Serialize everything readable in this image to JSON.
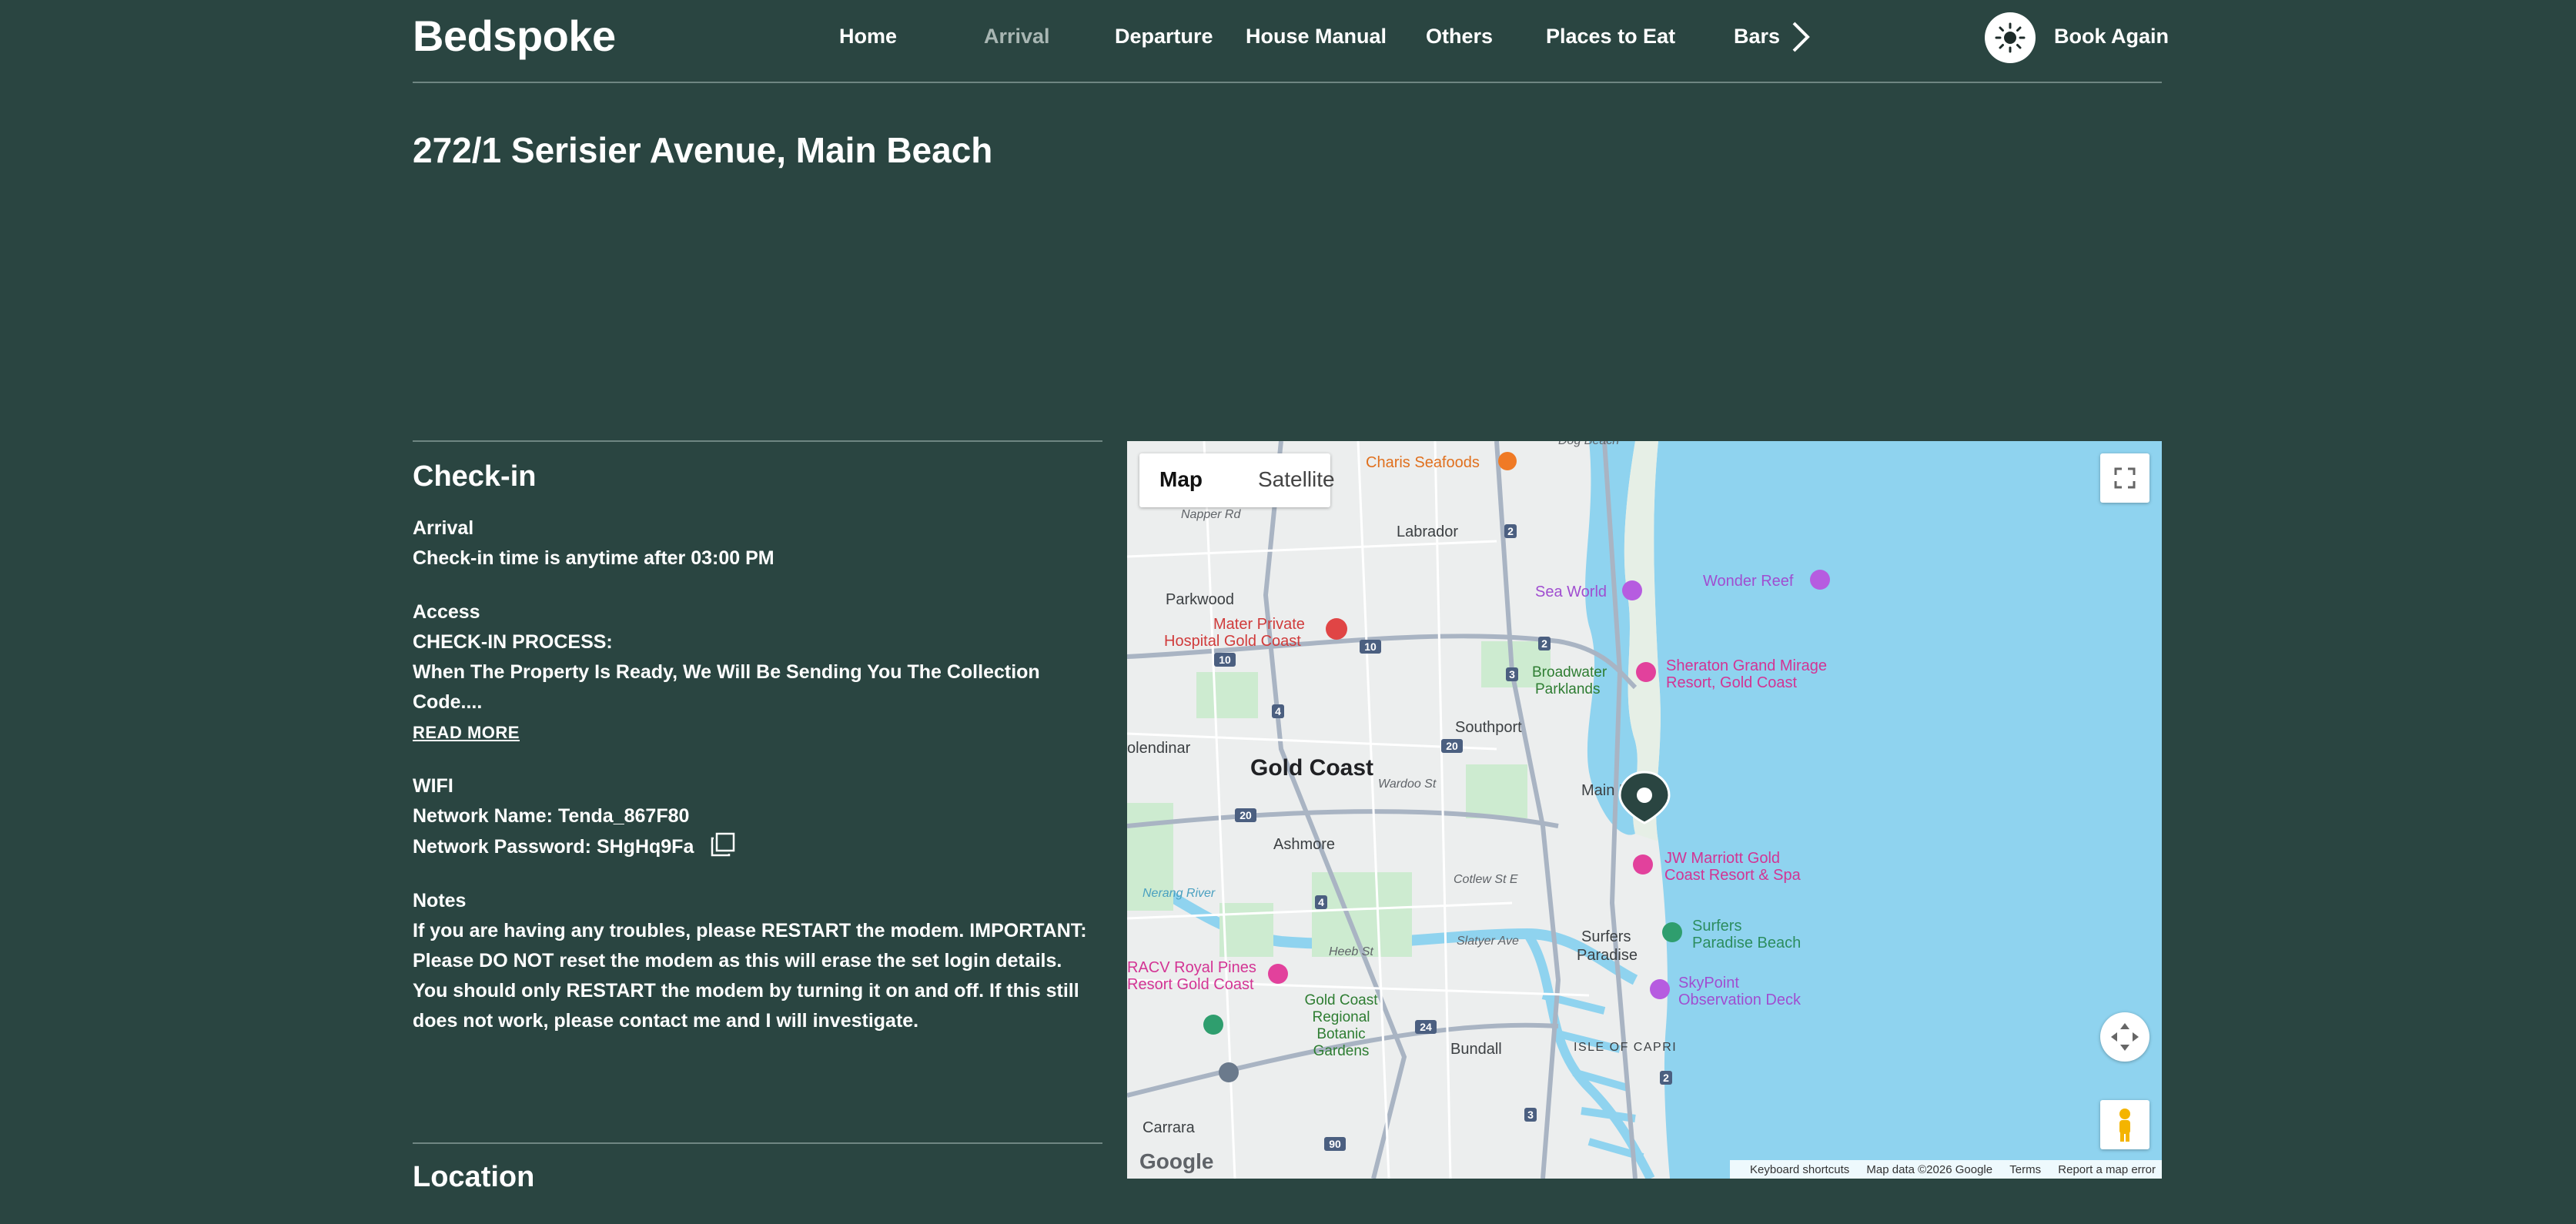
{
  "header": {
    "logo": "Bedspoke",
    "nav": [
      "Home",
      "Arrival",
      "Departure",
      "House Manual",
      "Others",
      "Places to Eat",
      "Bars"
    ],
    "active_nav": "Arrival",
    "book_again": "Book Again"
  },
  "page_title": "272/1 Serisier Avenue, Main Beach",
  "checkin": {
    "title": "Check-in",
    "arrival_label": "Arrival",
    "arrival_text": "Check-in time is anytime after 03:00 PM",
    "access_label": "Access",
    "access_heading": "CHECK-IN PROCESS:",
    "access_text_1": "When The Property Is Ready, We Will Be Sending You The Collection",
    "access_text_2": "Code....",
    "read_more": "READ MORE",
    "wifi_label": "WIFI",
    "network_name": "Network Name: Tenda_867F80",
    "network_password": "Network Password: SHgHq9Fa",
    "notes_label": "Notes",
    "notes_lines": [
      "If you are having any troubles, please RESTART the modem. IMPORTANT:",
      "Please DO NOT reset the modem as this will erase the set login details.",
      "You should only RESTART the modem by turning it on and off. If this still",
      "does not work, please contact me and I will investigate."
    ]
  },
  "location": {
    "title": "Location"
  },
  "map": {
    "tab_map": "Map",
    "tab_satellite": "Satellite",
    "google": "Google",
    "footer": [
      "Keyboard shortcuts",
      "Map data ©2026 Google",
      "Terms",
      "Report a map error"
    ],
    "labels": {
      "labrador": "Labrador",
      "parkwood": "Parkwood",
      "gold_coast": "Gold Coast",
      "southport": "Southport",
      "ashmore": "Ashmore",
      "main_beach": "Main Beach",
      "surfers_paradise_1": "Surfers",
      "surfers_paradise_2": "Paradise",
      "bundall": "Bundall",
      "carrara": "Carrara",
      "isle_of_capri": "ISLE OF CAPRI",
      "molendinar": "olendinar",
      "broadwater_1": "Broadwater",
      "broadwater_2": "Parklands",
      "charis": "Charis Seafoods",
      "sea_world": "Sea World",
      "wonder_reef": "Wonder Reef",
      "mater_1": "Mater Private",
      "mater_2": "Hospital Gold Coast",
      "sheraton_1": "Sheraton Grand Mirage",
      "sheraton_2": "Resort, Gold Coast",
      "jw_1": "JW Marriott Gold",
      "jw_2": "Coast Resort & Spa",
      "surfers_beach_1": "Surfers",
      "surfers_beach_2": "Paradise Beach",
      "skypoint_1": "SkyPoint",
      "skypoint_2": "Observation Deck",
      "racv_1": "RACV Royal Pines",
      "racv_2": "Resort Gold Coast",
      "botanic_1": "Gold Coast",
      "botanic_2": "Regional",
      "botanic_3": "Botanic",
      "botanic_4": "Gardens",
      "napper": "Napper Rd",
      "wardoo": "Wardoo St",
      "cotlew": "Cotlew St E",
      "slatyer": "Slatyer Ave",
      "heeb": "Heeb St",
      "nerang": "Nerang River",
      "dog_beach": "Dog Beach"
    },
    "route_numbers": [
      "2",
      "10",
      "10",
      "4",
      "3",
      "2",
      "20",
      "20",
      "4",
      "24",
      "3",
      "2",
      "90"
    ]
  },
  "colors": {
    "background": "#2a4541",
    "water": "#8fd3ef",
    "park": "#cdebd0",
    "road": "#a9b4c3"
  }
}
